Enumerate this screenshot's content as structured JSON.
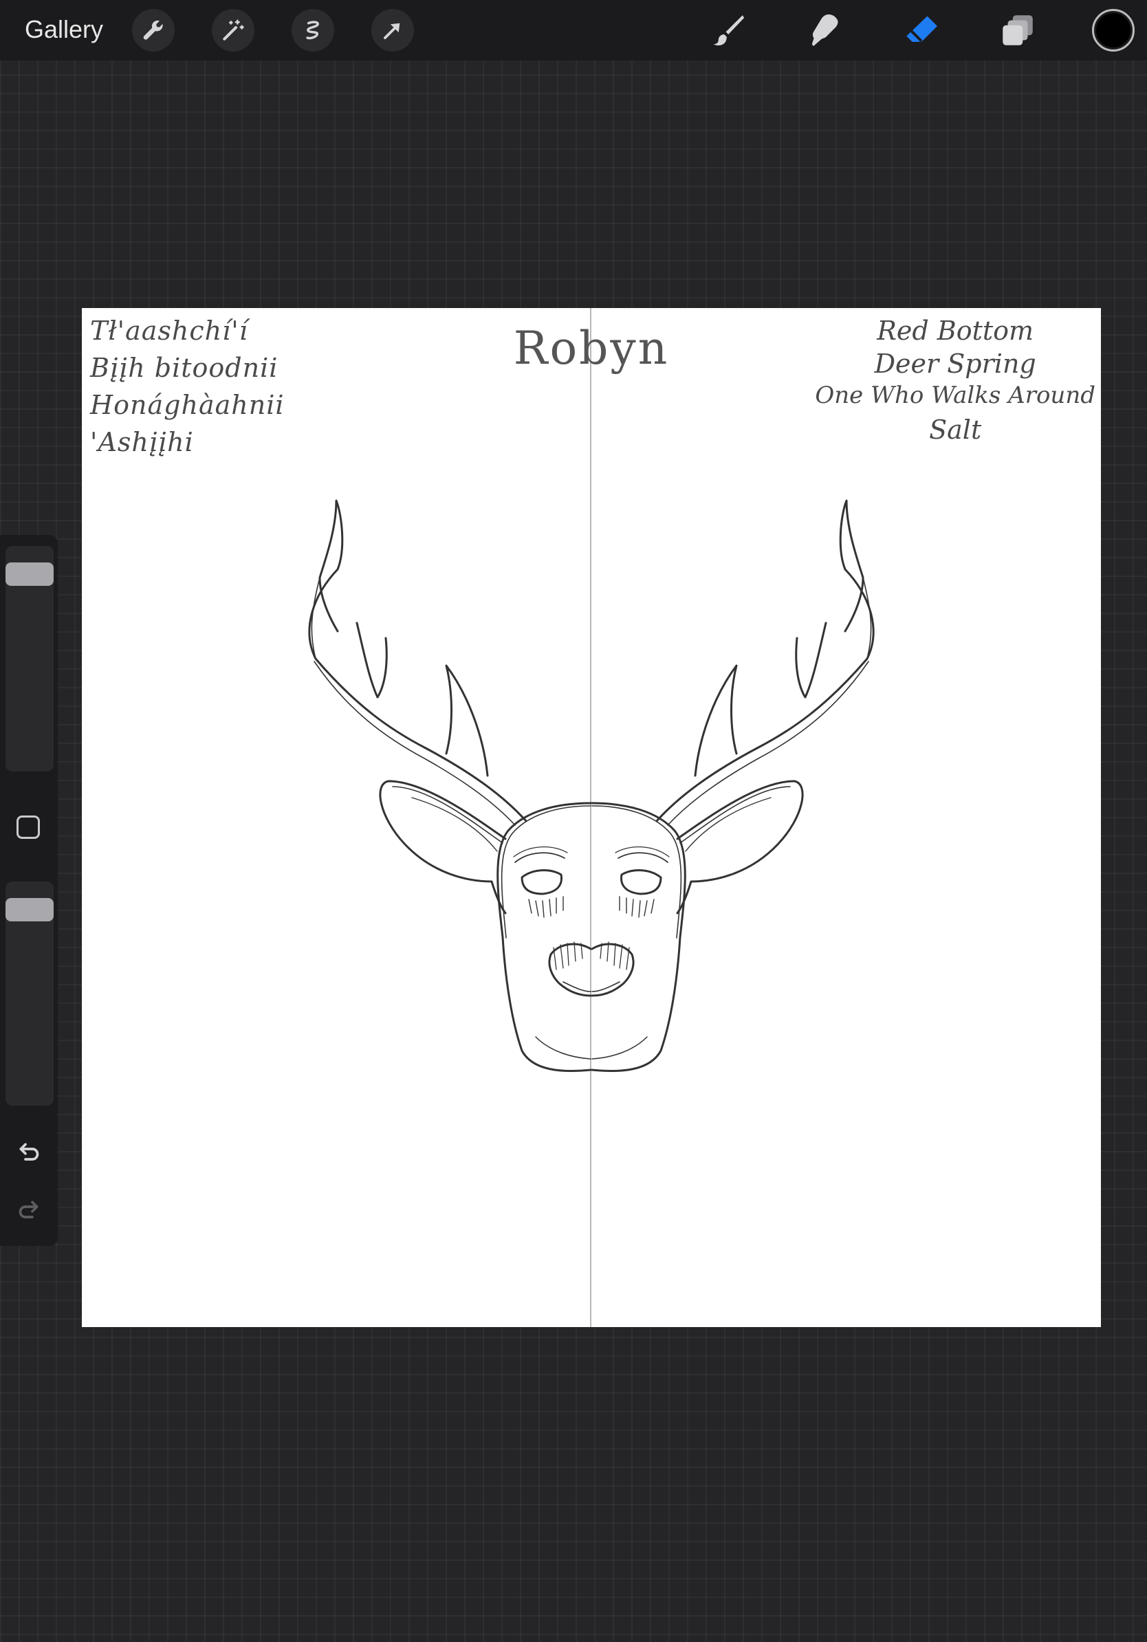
{
  "app": {
    "gallery_label": "Gallery"
  },
  "toolbar": {
    "left_tools": [
      "wrench-icon",
      "magic-wand-icon",
      "selection-icon",
      "transform-arrow-icon"
    ],
    "right_tools": [
      "brush-icon",
      "smudge-icon",
      "eraser-icon",
      "layers-icon"
    ],
    "active_tool": "eraser",
    "active_tool_color": "#1e7cf2",
    "current_color": "#000000"
  },
  "sidebar": {
    "brush_size_level": 0.05,
    "opacity_level": 0.05,
    "icons": [
      "modify-square-icon",
      "undo-icon",
      "redo-icon"
    ]
  },
  "canvas": {
    "title": "Robyn",
    "notes_left": [
      "Tł'aashchí'í",
      "Bįįh bitoodnii",
      "Honághàahnii",
      "'Ashįįhi"
    ],
    "notes_right": [
      "Red Bottom",
      "Deer Spring",
      "One Who Walks Around",
      "Salt"
    ],
    "symmetry_guide": true,
    "drawing": "deer-head-sketch"
  }
}
